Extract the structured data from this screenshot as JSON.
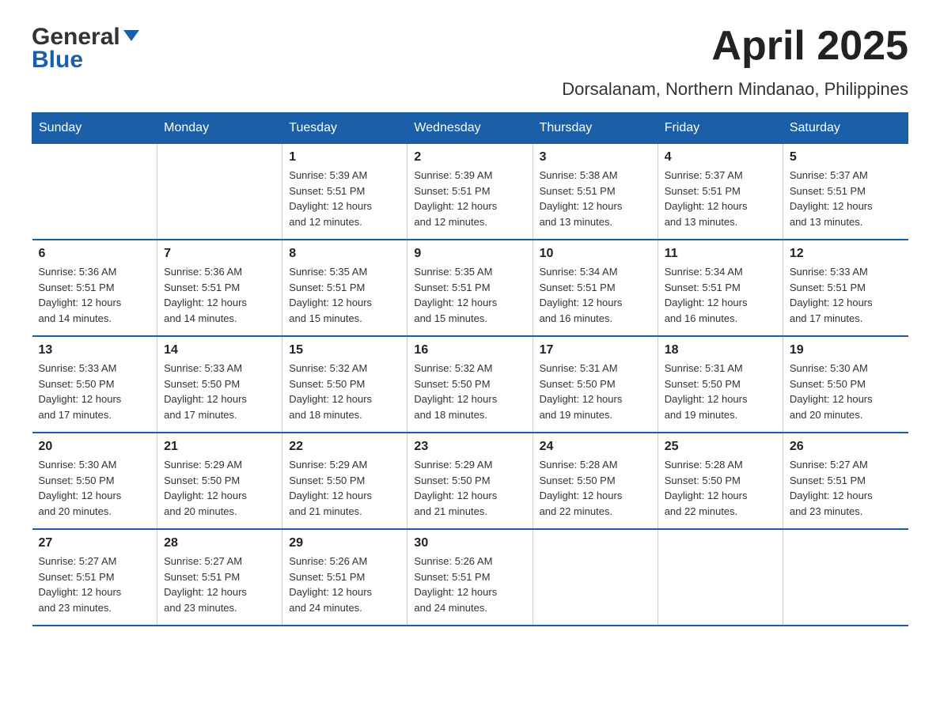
{
  "header": {
    "logo_general": "General",
    "logo_blue": "Blue",
    "month_title": "April 2025",
    "location": "Dorsalanam, Northern Mindanao, Philippines"
  },
  "weekdays": [
    "Sunday",
    "Monday",
    "Tuesday",
    "Wednesday",
    "Thursday",
    "Friday",
    "Saturday"
  ],
  "weeks": [
    [
      {
        "day": "",
        "info": ""
      },
      {
        "day": "",
        "info": ""
      },
      {
        "day": "1",
        "info": "Sunrise: 5:39 AM\nSunset: 5:51 PM\nDaylight: 12 hours\nand 12 minutes."
      },
      {
        "day": "2",
        "info": "Sunrise: 5:39 AM\nSunset: 5:51 PM\nDaylight: 12 hours\nand 12 minutes."
      },
      {
        "day": "3",
        "info": "Sunrise: 5:38 AM\nSunset: 5:51 PM\nDaylight: 12 hours\nand 13 minutes."
      },
      {
        "day": "4",
        "info": "Sunrise: 5:37 AM\nSunset: 5:51 PM\nDaylight: 12 hours\nand 13 minutes."
      },
      {
        "day": "5",
        "info": "Sunrise: 5:37 AM\nSunset: 5:51 PM\nDaylight: 12 hours\nand 13 minutes."
      }
    ],
    [
      {
        "day": "6",
        "info": "Sunrise: 5:36 AM\nSunset: 5:51 PM\nDaylight: 12 hours\nand 14 minutes."
      },
      {
        "day": "7",
        "info": "Sunrise: 5:36 AM\nSunset: 5:51 PM\nDaylight: 12 hours\nand 14 minutes."
      },
      {
        "day": "8",
        "info": "Sunrise: 5:35 AM\nSunset: 5:51 PM\nDaylight: 12 hours\nand 15 minutes."
      },
      {
        "day": "9",
        "info": "Sunrise: 5:35 AM\nSunset: 5:51 PM\nDaylight: 12 hours\nand 15 minutes."
      },
      {
        "day": "10",
        "info": "Sunrise: 5:34 AM\nSunset: 5:51 PM\nDaylight: 12 hours\nand 16 minutes."
      },
      {
        "day": "11",
        "info": "Sunrise: 5:34 AM\nSunset: 5:51 PM\nDaylight: 12 hours\nand 16 minutes."
      },
      {
        "day": "12",
        "info": "Sunrise: 5:33 AM\nSunset: 5:51 PM\nDaylight: 12 hours\nand 17 minutes."
      }
    ],
    [
      {
        "day": "13",
        "info": "Sunrise: 5:33 AM\nSunset: 5:50 PM\nDaylight: 12 hours\nand 17 minutes."
      },
      {
        "day": "14",
        "info": "Sunrise: 5:33 AM\nSunset: 5:50 PM\nDaylight: 12 hours\nand 17 minutes."
      },
      {
        "day": "15",
        "info": "Sunrise: 5:32 AM\nSunset: 5:50 PM\nDaylight: 12 hours\nand 18 minutes."
      },
      {
        "day": "16",
        "info": "Sunrise: 5:32 AM\nSunset: 5:50 PM\nDaylight: 12 hours\nand 18 minutes."
      },
      {
        "day": "17",
        "info": "Sunrise: 5:31 AM\nSunset: 5:50 PM\nDaylight: 12 hours\nand 19 minutes."
      },
      {
        "day": "18",
        "info": "Sunrise: 5:31 AM\nSunset: 5:50 PM\nDaylight: 12 hours\nand 19 minutes."
      },
      {
        "day": "19",
        "info": "Sunrise: 5:30 AM\nSunset: 5:50 PM\nDaylight: 12 hours\nand 20 minutes."
      }
    ],
    [
      {
        "day": "20",
        "info": "Sunrise: 5:30 AM\nSunset: 5:50 PM\nDaylight: 12 hours\nand 20 minutes."
      },
      {
        "day": "21",
        "info": "Sunrise: 5:29 AM\nSunset: 5:50 PM\nDaylight: 12 hours\nand 20 minutes."
      },
      {
        "day": "22",
        "info": "Sunrise: 5:29 AM\nSunset: 5:50 PM\nDaylight: 12 hours\nand 21 minutes."
      },
      {
        "day": "23",
        "info": "Sunrise: 5:29 AM\nSunset: 5:50 PM\nDaylight: 12 hours\nand 21 minutes."
      },
      {
        "day": "24",
        "info": "Sunrise: 5:28 AM\nSunset: 5:50 PM\nDaylight: 12 hours\nand 22 minutes."
      },
      {
        "day": "25",
        "info": "Sunrise: 5:28 AM\nSunset: 5:50 PM\nDaylight: 12 hours\nand 22 minutes."
      },
      {
        "day": "26",
        "info": "Sunrise: 5:27 AM\nSunset: 5:51 PM\nDaylight: 12 hours\nand 23 minutes."
      }
    ],
    [
      {
        "day": "27",
        "info": "Sunrise: 5:27 AM\nSunset: 5:51 PM\nDaylight: 12 hours\nand 23 minutes."
      },
      {
        "day": "28",
        "info": "Sunrise: 5:27 AM\nSunset: 5:51 PM\nDaylight: 12 hours\nand 23 minutes."
      },
      {
        "day": "29",
        "info": "Sunrise: 5:26 AM\nSunset: 5:51 PM\nDaylight: 12 hours\nand 24 minutes."
      },
      {
        "day": "30",
        "info": "Sunrise: 5:26 AM\nSunset: 5:51 PM\nDaylight: 12 hours\nand 24 minutes."
      },
      {
        "day": "",
        "info": ""
      },
      {
        "day": "",
        "info": ""
      },
      {
        "day": "",
        "info": ""
      }
    ]
  ]
}
